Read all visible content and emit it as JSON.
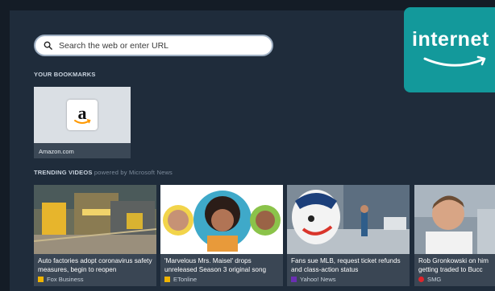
{
  "search": {
    "placeholder": "Search the web or enter URL"
  },
  "bookmarks": {
    "heading": "YOUR BOOKMARKS",
    "items": [
      {
        "name": "Amazon.com",
        "icon": "amazon-logo-icon"
      }
    ]
  },
  "trending": {
    "heading": "TRENDING VIDEOS",
    "powered_by": "powered by Microsoft News",
    "items": [
      {
        "title": "Auto factories adopt coronavirus safety measures, begin to reopen",
        "source": "Fox Business",
        "source_color": "#f0b400"
      },
      {
        "title": "'Marvelous Mrs. Maisel' drops unreleased Season 3 original song",
        "source": "ETonline",
        "source_color": "#f0b400"
      },
      {
        "title": "Fans sue MLB, request ticket refunds and class-action status",
        "source": "Yahoo! News",
        "source_color": "#6b2fb3"
      },
      {
        "title": "Rob Gronkowski on him getting traded to Bucc",
        "source": "SMG",
        "source_color": "#e0242b"
      }
    ]
  },
  "brand": {
    "text": "internet",
    "color": "#13999b",
    "accent": "#ff9900"
  }
}
